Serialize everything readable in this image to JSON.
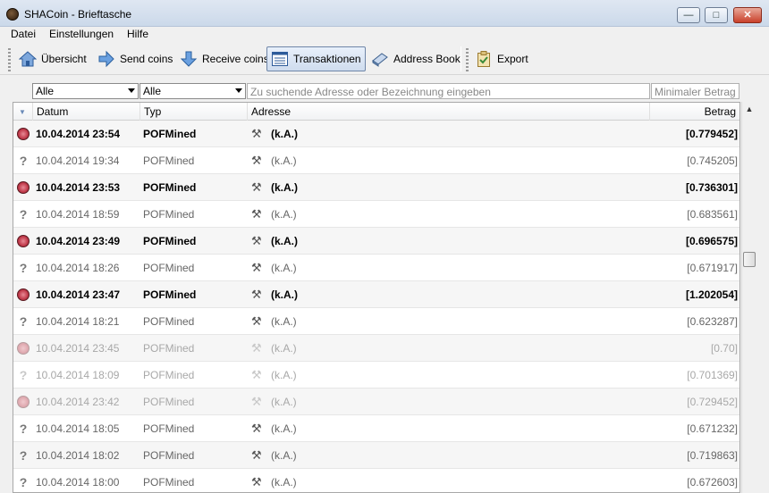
{
  "window": {
    "title": "SHACoin - Brieftasche",
    "minimize_label": "—",
    "maximize_label": "□",
    "close_label": "✕"
  },
  "menu": {
    "items": [
      "Datei",
      "Einstellungen",
      "Hilfe"
    ]
  },
  "toolbar": {
    "overview_label": "Übersicht",
    "send_label": "Send coins",
    "receive_label": "Receive coins",
    "transactions_label": "Transaktionen",
    "addressbook_label": "Address Book",
    "export_label": "Export"
  },
  "filters": {
    "date_filter_value": "Alle",
    "type_filter_value": "Alle",
    "search_placeholder": "Zu suchende Adresse oder Bezeichnung eingeben",
    "min_amount_placeholder": "Minimaler Betrag"
  },
  "table": {
    "headers": {
      "date": "Datum",
      "type": "Typ",
      "address": "Adresse",
      "amount": "Betrag"
    },
    "rows": [
      {
        "status": "confirmed",
        "date": "10.04.2014 23:54",
        "type": "POFMined",
        "address": "(k.A.)",
        "amount": "[0.779452]"
      },
      {
        "status": "pending",
        "date": "10.04.2014 19:34",
        "type": "POFMined",
        "address": "(k.A.)",
        "amount": "[0.745205]"
      },
      {
        "status": "confirmed",
        "date": "10.04.2014 23:53",
        "type": "POFMined",
        "address": "(k.A.)",
        "amount": "[0.736301]"
      },
      {
        "status": "pending",
        "date": "10.04.2014 18:59",
        "type": "POFMined",
        "address": "(k.A.)",
        "amount": "[0.683561]"
      },
      {
        "status": "confirmed",
        "date": "10.04.2014 23:49",
        "type": "POFMined",
        "address": "(k.A.)",
        "amount": "[0.696575]"
      },
      {
        "status": "pending",
        "date": "10.04.2014 18:26",
        "type": "POFMined",
        "address": "(k.A.)",
        "amount": "[0.671917]"
      },
      {
        "status": "confirmed",
        "date": "10.04.2014 23:47",
        "type": "POFMined",
        "address": "(k.A.)",
        "amount": "[1.202054]"
      },
      {
        "status": "pending",
        "date": "10.04.2014 18:21",
        "type": "POFMined",
        "address": "(k.A.)",
        "amount": "[0.623287]"
      },
      {
        "status": "faded",
        "date": "10.04.2014 23:45",
        "type": "POFMined",
        "address": "(k.A.)",
        "amount": "[0.70]"
      },
      {
        "status": "faded-q",
        "date": "10.04.2014 18:09",
        "type": "POFMined",
        "address": "(k.A.)",
        "amount": "[0.701369]"
      },
      {
        "status": "faded",
        "date": "10.04.2014 23:42",
        "type": "POFMined",
        "address": "(k.A.)",
        "amount": "[0.729452]"
      },
      {
        "status": "pending",
        "date": "10.04.2014 18:05",
        "type": "POFMined",
        "address": "(k.A.)",
        "amount": "[0.671232]"
      },
      {
        "status": "pending",
        "date": "10.04.2014 18:02",
        "type": "POFMined",
        "address": "(k.A.)",
        "amount": "[0.719863]"
      },
      {
        "status": "pending",
        "date": "10.04.2014 18:00",
        "type": "POFMined",
        "address": "(k.A.)",
        "amount": "[0.672603]"
      }
    ]
  }
}
